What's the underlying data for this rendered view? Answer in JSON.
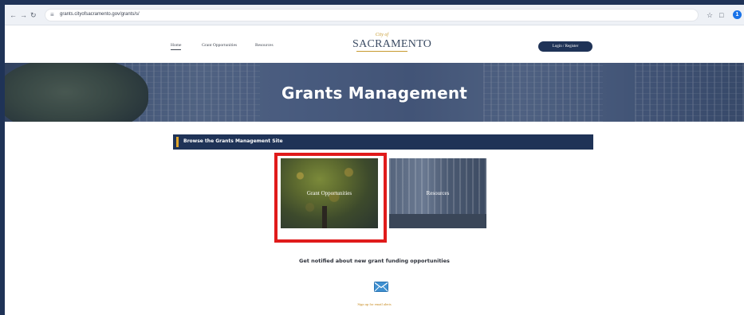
{
  "browser": {
    "url": "grants.cityofsacramento.gov/grants/s/",
    "back_icon": "arrow-left-icon",
    "forward_icon": "arrow-right-icon",
    "reload_icon": "reload-icon",
    "bookmark_icon": "star-icon",
    "extensions_icon": "puzzle-icon",
    "profile_initial": "1"
  },
  "nav": {
    "home": "Home",
    "grant_opportunities": "Grant Opportunities",
    "resources": "Resources"
  },
  "logo": {
    "city": "City of",
    "name": "SACRAMENTO"
  },
  "header": {
    "login_label": "Login / Register"
  },
  "hero": {
    "title": "Grants Management"
  },
  "browse": {
    "label": "Browse the Grants Management Site"
  },
  "tiles": [
    {
      "label": "Grant Opportunities"
    },
    {
      "label": "Resources"
    }
  ],
  "notify": {
    "heading": "Get notified about new grant funding opportunities",
    "icon": "envelope-icon",
    "link": "Sign up for email alerts"
  },
  "colors": {
    "brand_navy": "#1f3357",
    "accent_gold": "#e0a52b",
    "highlight_red": "#e01b1b",
    "link_orange": "#c78a1f"
  }
}
